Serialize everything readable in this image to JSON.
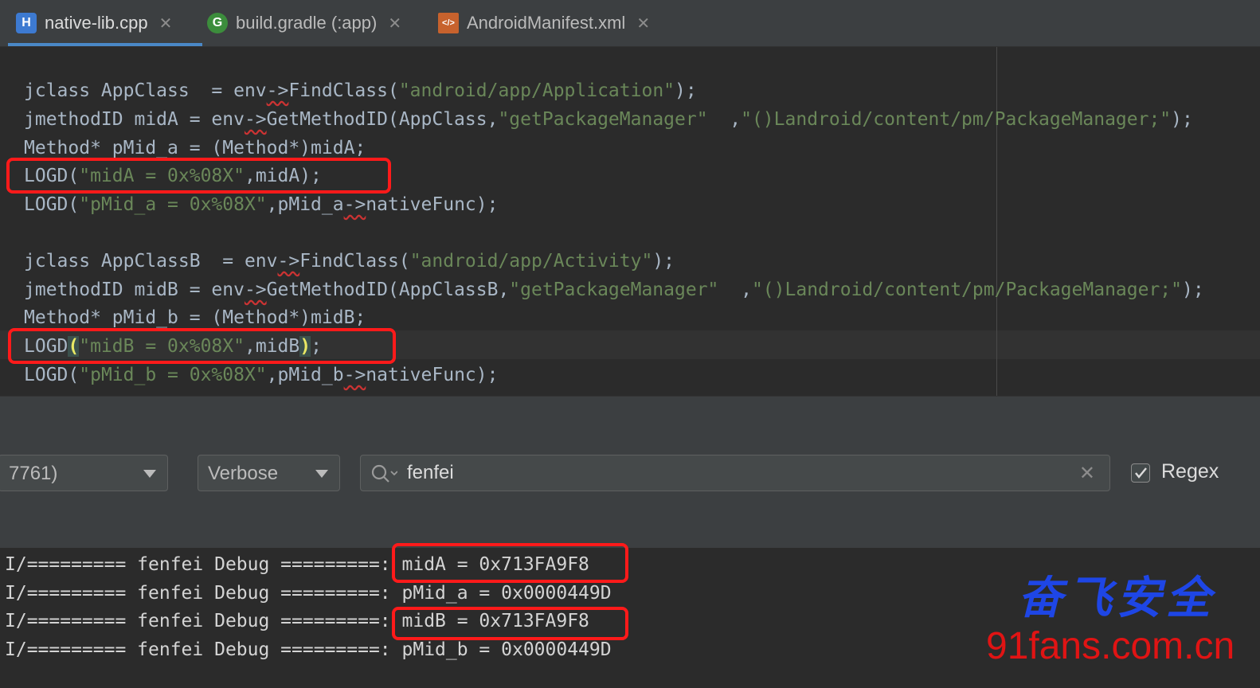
{
  "tabs": [
    {
      "label": "native-lib.cpp",
      "icon": "H",
      "icon_color": "#3d7ad1",
      "active": true
    },
    {
      "label": "build.gradle (:app)",
      "icon": "G",
      "icon_color": "#3c8d3c",
      "active": false
    },
    {
      "label": "AndroidManifest.xml",
      "icon": "</>",
      "icon_color": "#c7622d",
      "active": false
    }
  ],
  "code": {
    "l1a": "jclass AppClass  = env",
    "l1b": "->",
    "l1c": "FindClass(",
    "l1s": "\"android/app/Application\"",
    "l1d": ");",
    "l2a": "jmethodID midA = env",
    "l2b": "->",
    "l2c": "GetMethodID(AppClass,",
    "l2s1": "\"getPackageManager\"",
    "l2d": "  ,",
    "l2s2": "\"()Landroid/content/pm/PackageManager;\"",
    "l2e": ");",
    "l3": "Method* pMid_a = (Method*)midA;",
    "l4a": "LOGD(",
    "l4s": "\"midA = 0x%08X\"",
    "l4b": ",midA);",
    "l5a": "LOGD(",
    "l5s": "\"pMid_a = 0x%08X\"",
    "l5b": ",pMid_a",
    "l5c": "->",
    "l5d": "nativeFunc);",
    "l6a": "jclass AppClassB  = env",
    "l6b": "->",
    "l6c": "FindClass(",
    "l6s": "\"android/app/Activity\"",
    "l6d": ");",
    "l7a": "jmethodID midB = env",
    "l7b": "->",
    "l7c": "GetMethodID(AppClassB,",
    "l7s1": "\"getPackageManager\"",
    "l7d": "  ,",
    "l7s2": "\"()Landroid/content/pm/PackageManager;\"",
    "l7e": ");",
    "l8": "Method* pMid_b = (Method*)midB;",
    "l9a": "LOGD",
    "l9p1": "(",
    "l9s": "\"midB = 0x%08X\"",
    "l9b": ",midB",
    "l9p2": ")",
    "l9c": ";",
    "l10a": "LOGD(",
    "l10s": "\"pMid_b = 0x%08X\"",
    "l10b": ",pMid_b",
    "l10c": "->",
    "l10d": "nativeFunc);"
  },
  "logcat": {
    "process_value": "7761)",
    "level_value": "Verbose",
    "search_value": "fenfei",
    "regex_label": "Regex",
    "regex_checked": true
  },
  "console": {
    "prefix": "I/========= fenfei Debug =========: ",
    "lines": [
      "midA = 0x713FA9F8",
      "pMid_a = 0x0000449D",
      "midB = 0x713FA9F8",
      "pMid_b = 0x0000449D"
    ]
  },
  "watermark": {
    "cn": "奋飞安全",
    "url": "91fans.com.cn"
  }
}
